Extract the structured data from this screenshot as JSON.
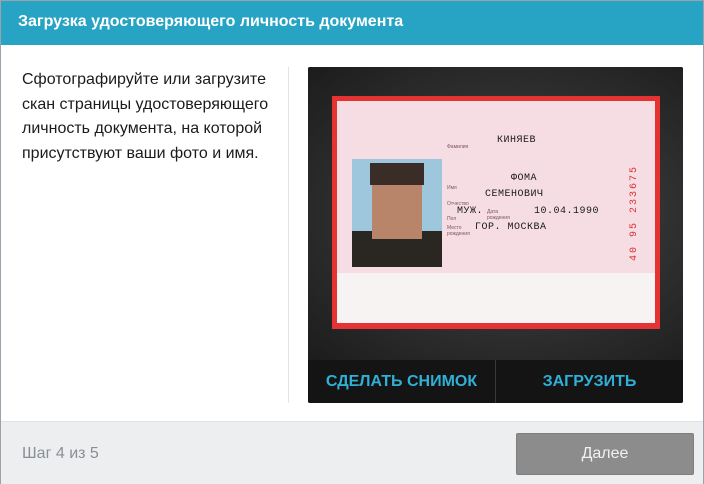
{
  "header": {
    "title": "Загрузка удостоверяющего личность документа"
  },
  "instructions": {
    "text": "Сфотографируйте или загрузите скан страницы удостоверяющего личность документа, на которой присутствуют ваши фото и имя."
  },
  "document": {
    "labels": {
      "surname": "Фамилия",
      "name": "Имя",
      "patronymic": "Отчество",
      "sex": "Пол",
      "birth_date": "Дата рождения",
      "birth_place": "Место рождения"
    },
    "surname": "КИНЯЕВ",
    "name": "ФОМА",
    "patronymic": "СЕМЕНОВИЧ",
    "sex": "МУЖ.",
    "birth_date": "10.04.1990",
    "birth_place": "ГОР. МОСКВА",
    "serial": "40 95 233675"
  },
  "camera": {
    "take_photo_label": "СДЕЛАТЬ СНИМОК",
    "upload_label": "ЗАГРУЗИТЬ"
  },
  "footer": {
    "step": "Шаг 4 из 5",
    "next_label": "Далее"
  },
  "colors": {
    "accent": "#27a3c4",
    "camera_button_text": "#2fb0d6",
    "next_button": "#8c8c8c"
  }
}
